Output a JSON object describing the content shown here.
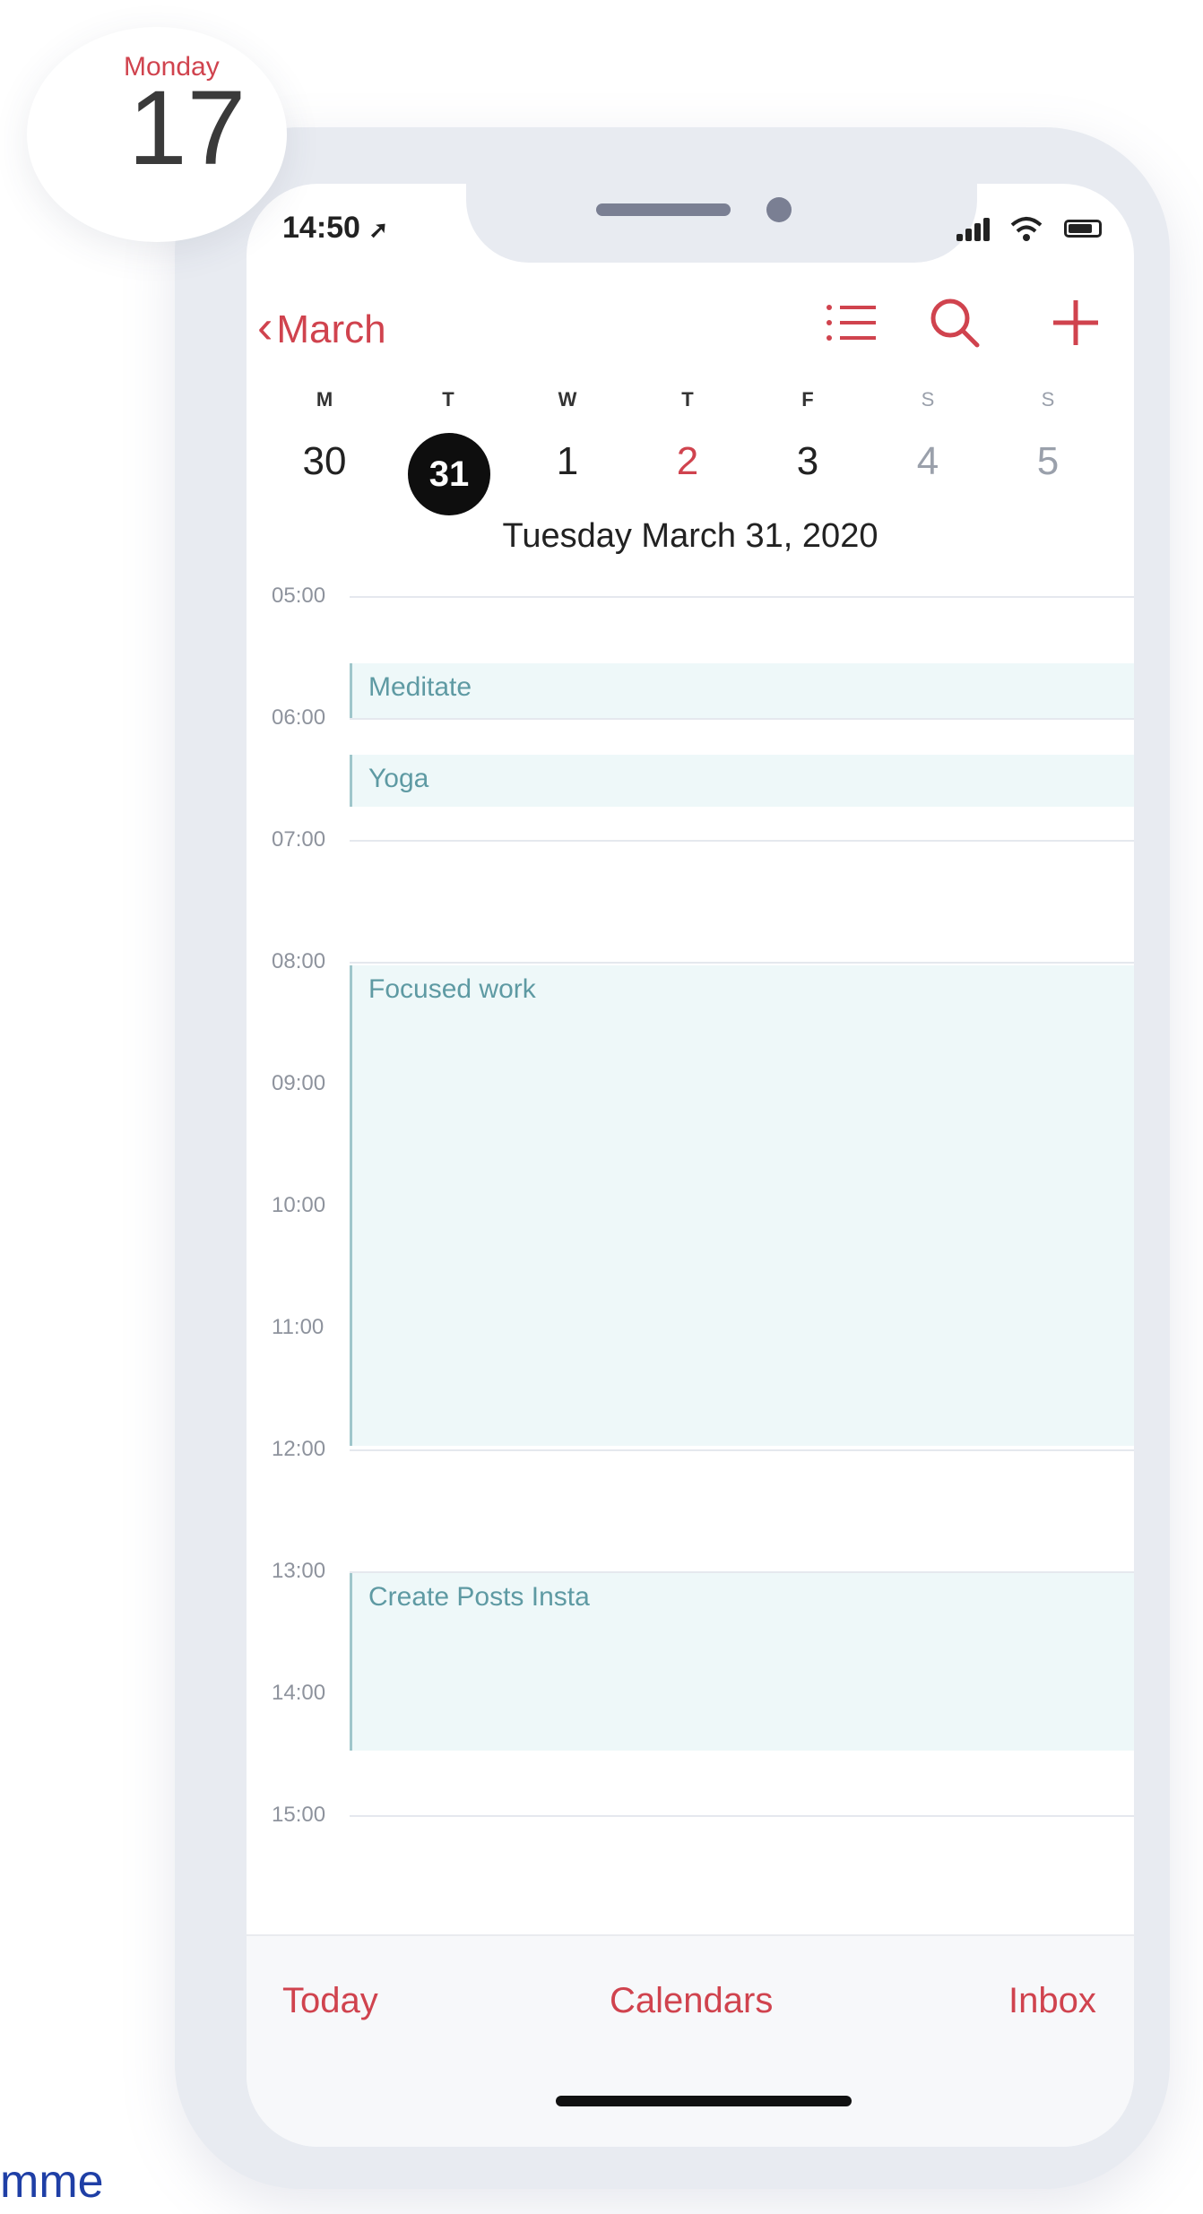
{
  "icon": {
    "day_name": "Monday",
    "day_number": "17"
  },
  "status": {
    "time": "14:50"
  },
  "header": {
    "back_label": "March",
    "icons": [
      "list-icon",
      "search-icon",
      "add-icon"
    ],
    "accent": "#d0434e"
  },
  "week": {
    "letters": [
      "M",
      "T",
      "W",
      "T",
      "F",
      "S",
      "S"
    ],
    "days": [
      "30",
      "31",
      "1",
      "2",
      "3",
      "4",
      "5"
    ],
    "selected_day": "31",
    "highlighted_day": "2"
  },
  "date_title": "Tuesday  March 31, 2020",
  "hours": [
    "05:00",
    "06:00",
    "07:00",
    "08:00",
    "09:00",
    "10:00",
    "11:00",
    "12:00",
    "13:00",
    "14:00",
    "15:00"
  ],
  "events": [
    {
      "title": "Meditate"
    },
    {
      "title": "Yoga"
    },
    {
      "title": "Focused work"
    },
    {
      "title": "Create Posts Insta"
    }
  ],
  "tabs": {
    "today": "Today",
    "calendars": "Calendars",
    "inbox": "Inbox"
  },
  "footer_text": "mme"
}
